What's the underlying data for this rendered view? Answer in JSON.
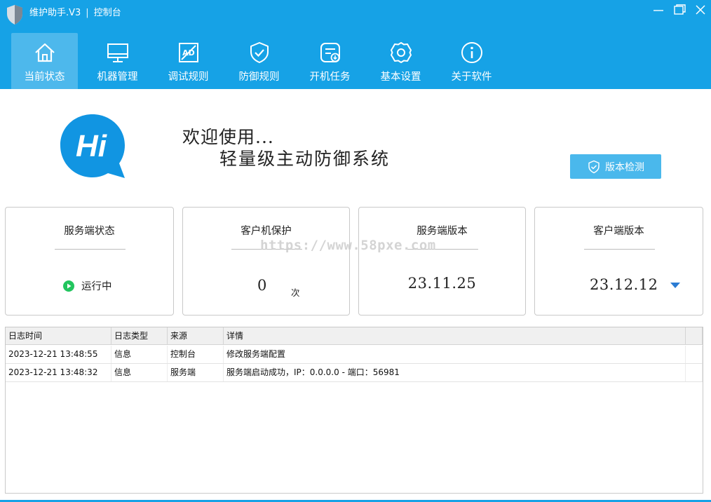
{
  "colors": {
    "brand": "#16a2e6",
    "button": "#4ab8ec",
    "running": "#22c55e",
    "arrow": "#2b7cd3"
  },
  "window": {
    "title": "维护助手.V3",
    "separator": "|",
    "subtitle": "控制台"
  },
  "nav": [
    {
      "label": "当前状态",
      "icon": "home-icon",
      "active": true
    },
    {
      "label": "机器管理",
      "icon": "monitor-icon",
      "active": false
    },
    {
      "label": "调试规则",
      "icon": "ad-block-icon",
      "active": false
    },
    {
      "label": "防御规则",
      "icon": "shield-check-icon",
      "active": false
    },
    {
      "label": "开机任务",
      "icon": "task-icon",
      "active": false
    },
    {
      "label": "基本设置",
      "icon": "settings-icon",
      "active": false
    },
    {
      "label": "关于软件",
      "icon": "info-icon",
      "active": false
    }
  ],
  "welcome": {
    "hi": "Hi",
    "line1": "欢迎使用...",
    "line2": "轻量级主动防御系统"
  },
  "version_check_label": "版本检测",
  "cards": {
    "status": {
      "title": "服务端状态",
      "value": "运行中"
    },
    "protect": {
      "title": "客户机保护",
      "count": "0",
      "unit": "次"
    },
    "server_version": {
      "title": "服务端版本",
      "value": "23.11.25"
    },
    "client_version": {
      "title": "客户端版本",
      "value": "23.12.12"
    }
  },
  "watermark": "https://www.58pxe.com",
  "log": {
    "columns": [
      "日志时间",
      "日志类型",
      "来源",
      "详情"
    ],
    "rows": [
      [
        "2023-12-21 13:48:55",
        "信息",
        "控制台",
        "修改服务端配置"
      ],
      [
        "2023-12-21 13:48:32",
        "信息",
        "服务端",
        "服务端启动成功，IP：0.0.0.0 - 端口：56981"
      ]
    ]
  }
}
